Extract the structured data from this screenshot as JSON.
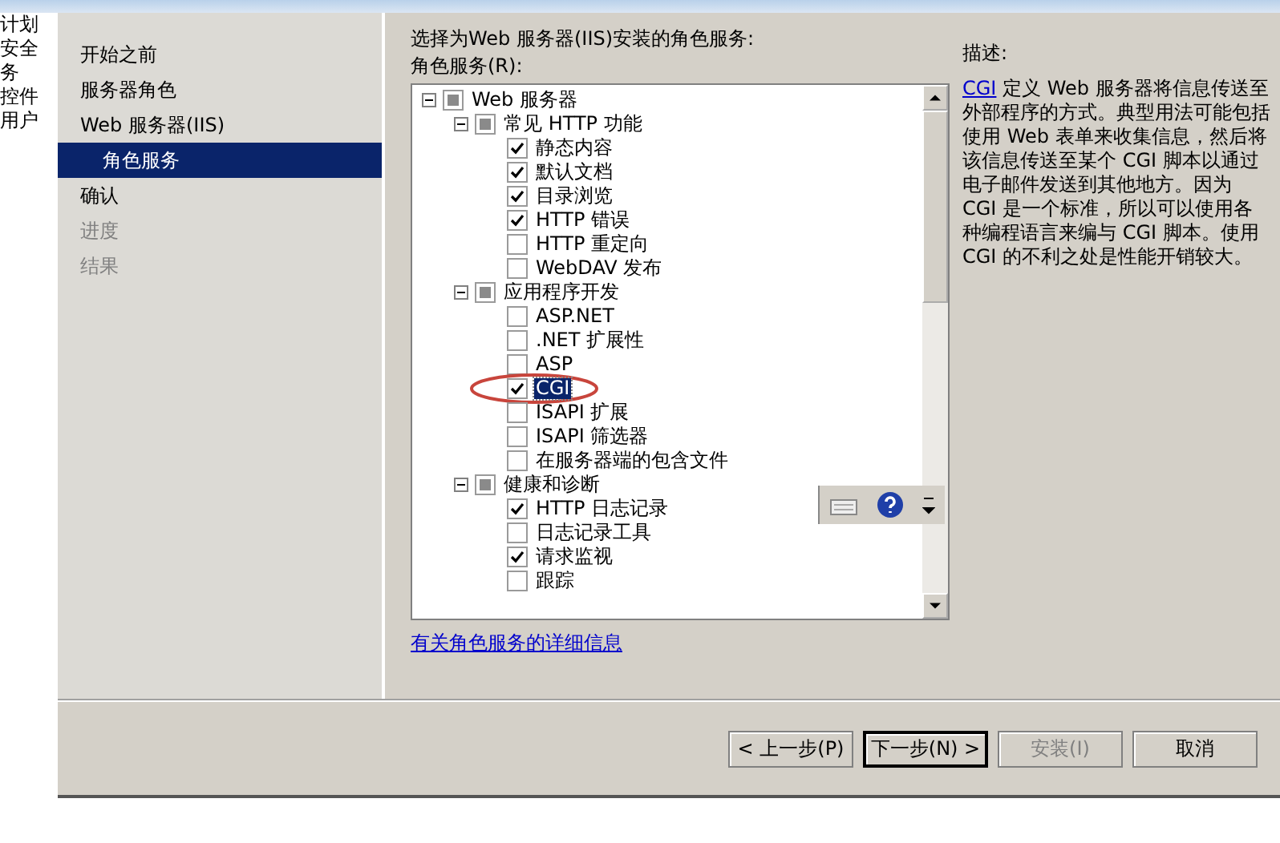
{
  "background_window": {
    "lines": [
      "计划",
      "安全",
      "务",
      "控件",
      "用户"
    ]
  },
  "nav": {
    "items": [
      {
        "label": "开始之前",
        "selected": false,
        "disabled": false
      },
      {
        "label": "服务器角色",
        "selected": false,
        "disabled": false
      },
      {
        "label": "Web 服务器(IIS)",
        "selected": false,
        "disabled": false,
        "children": [
          {
            "label": "角色服务",
            "selected": true,
            "disabled": false
          }
        ]
      },
      {
        "label": "确认",
        "selected": false,
        "disabled": false
      },
      {
        "label": "进度",
        "selected": false,
        "disabled": true
      },
      {
        "label": "结果",
        "selected": false,
        "disabled": true
      }
    ]
  },
  "instruction": "选择为Web 服务器(IIS)安装的角色服务:",
  "tree_label": "角色服务(R):",
  "tree": [
    {
      "label": "Web 服务器",
      "expanded": true,
      "indeterminate": true,
      "selected": false,
      "children": [
        {
          "label": "常见 HTTP 功能",
          "expanded": true,
          "indeterminate": true,
          "selected": false,
          "children": [
            {
              "label": "静态内容",
              "checked": true,
              "selected": false
            },
            {
              "label": "默认文档",
              "checked": true,
              "selected": false
            },
            {
              "label": "目录浏览",
              "checked": true,
              "selected": false
            },
            {
              "label": "HTTP 错误",
              "checked": true,
              "selected": false
            },
            {
              "label": "HTTP 重定向",
              "checked": false,
              "selected": false
            },
            {
              "label": "WebDAV 发布",
              "checked": false,
              "selected": false
            }
          ]
        },
        {
          "label": "应用程序开发",
          "expanded": true,
          "indeterminate": true,
          "selected": false,
          "children": [
            {
              "label": "ASP.NET",
              "checked": false,
              "selected": false
            },
            {
              "label": ".NET 扩展性",
              "checked": false,
              "selected": false
            },
            {
              "label": "ASP",
              "checked": false,
              "selected": false
            },
            {
              "label": "CGI",
              "checked": true,
              "selected": true,
              "circled": true
            },
            {
              "label": "ISAPI 扩展",
              "checked": false,
              "selected": false
            },
            {
              "label": "ISAPI 筛选器",
              "checked": false,
              "selected": false
            },
            {
              "label": "在服务器端的包含文件",
              "checked": false,
              "selected": false
            }
          ]
        },
        {
          "label": "健康和诊断",
          "expanded": true,
          "indeterminate": true,
          "selected": false,
          "children": [
            {
              "label": "HTTP 日志记录",
              "checked": true,
              "selected": false
            },
            {
              "label": "日志记录工具",
              "checked": false,
              "selected": false
            },
            {
              "label": "请求监视",
              "checked": true,
              "selected": false
            },
            {
              "label": "跟踪",
              "checked": false,
              "selected": false
            }
          ]
        }
      ]
    }
  ],
  "more_info_link": "有关角色服务的详细信息",
  "description": {
    "title": "描述:",
    "link": "CGI",
    "text": " 定义 Web 服务器将信息传送至外部程序的方式。典型用法可能包括使用 Web 表单来收集信息，然后将该信息传送至某个 CGI 脚本以通过电子邮件发送到其他地方。因为 CGI 是一个标准，所以可以使用各种编程语言来编与 CGI 脚本。使用 CGI 的不利之处是性能开销较大。"
  },
  "buttons": [
    {
      "label": "< 上一步(P)",
      "disabled": false,
      "default": false
    },
    {
      "label": "下一步(N) >",
      "disabled": false,
      "default": true
    },
    {
      "label": "安装(I)",
      "disabled": true,
      "default": false
    },
    {
      "label": "取消",
      "disabled": false,
      "default": false
    }
  ]
}
